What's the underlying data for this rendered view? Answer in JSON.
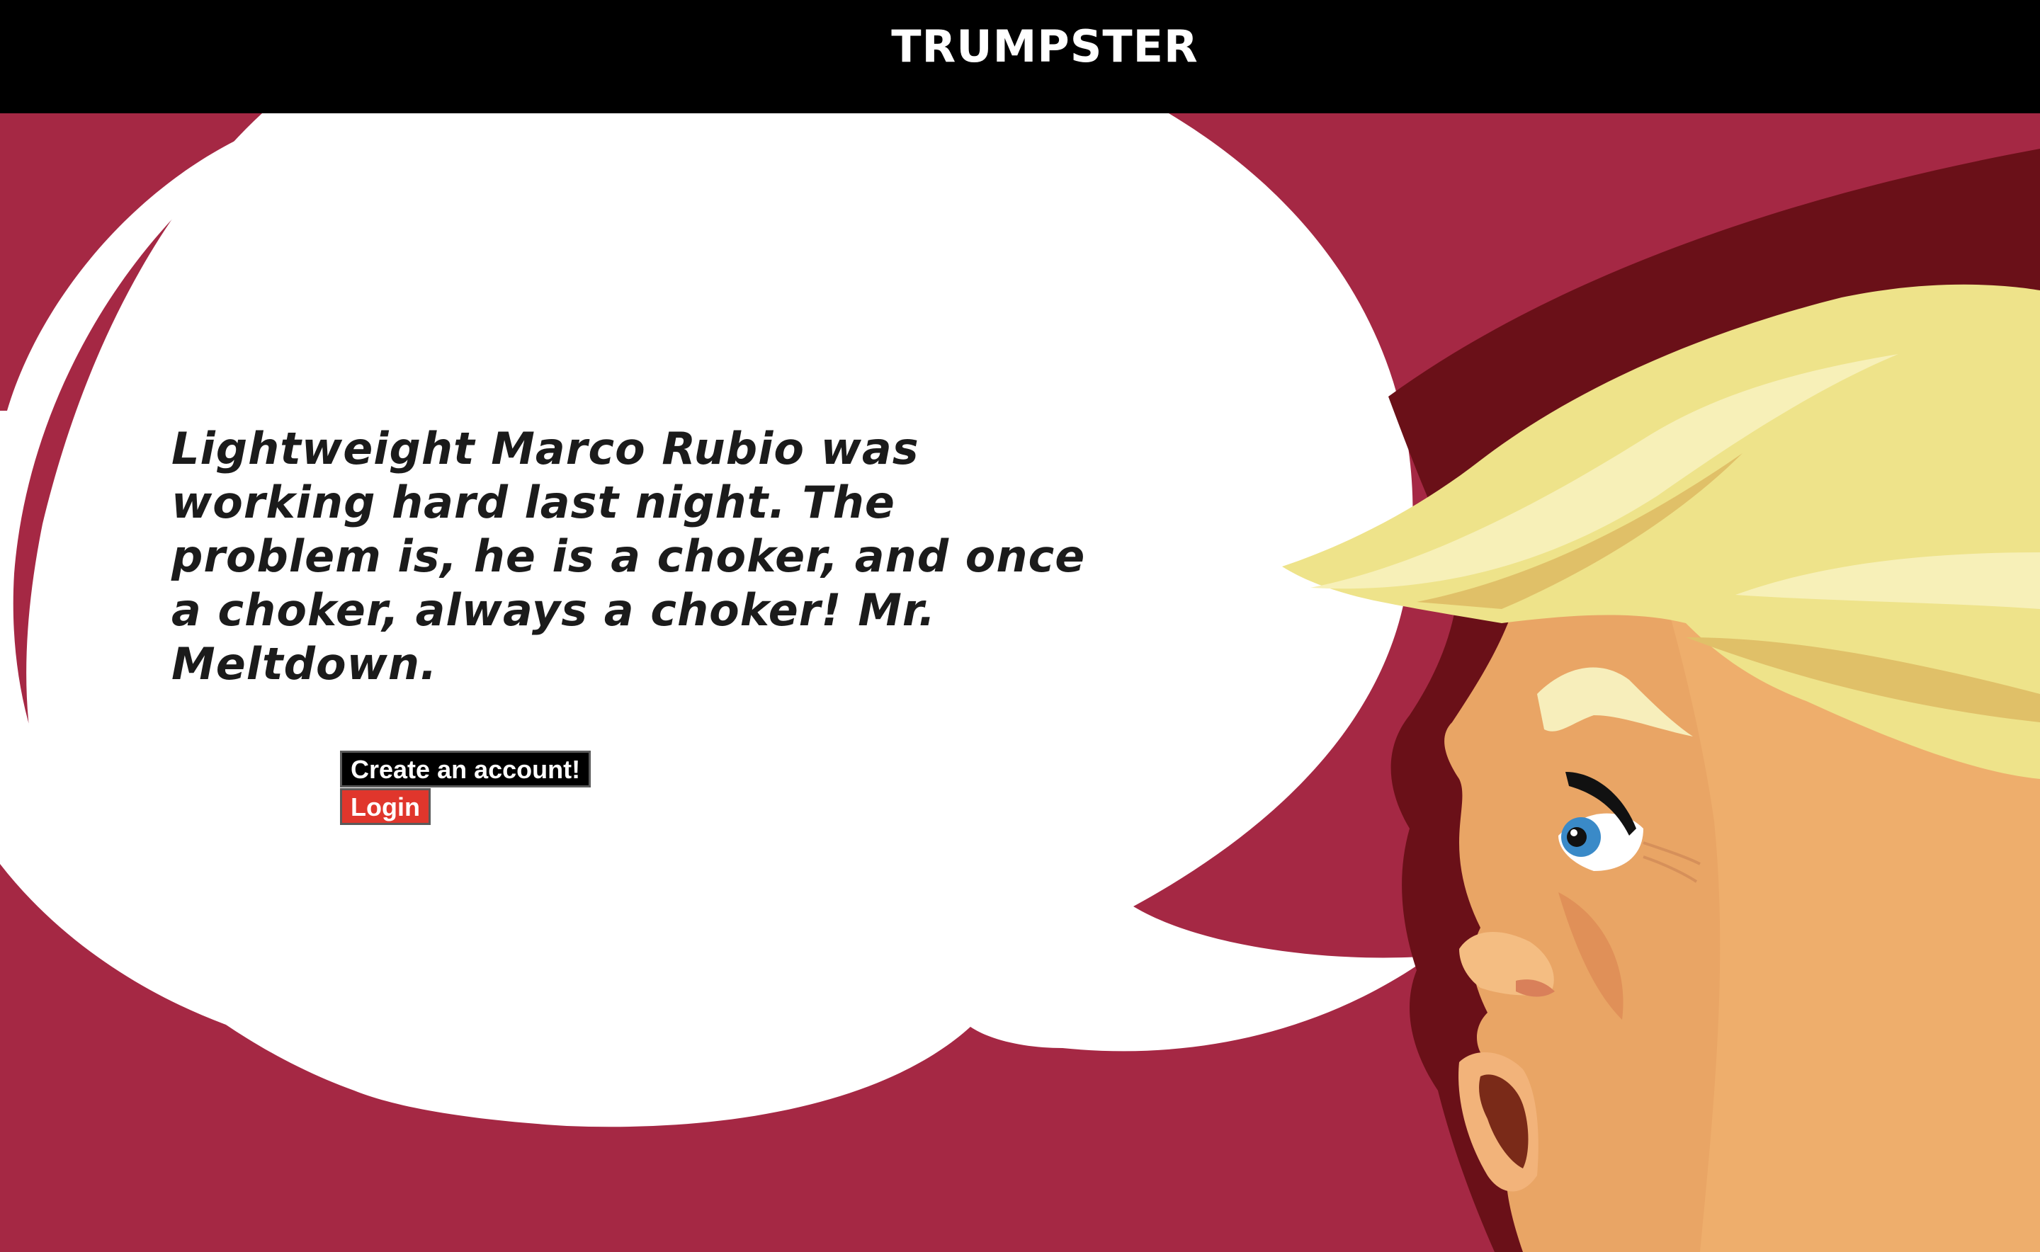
{
  "header": {
    "title": "TRUMPSTER"
  },
  "main": {
    "quote": "Lightweight Marco Rubio was working hard last night. The problem is, he is a choker, and once a choker, always a choker! Mr. Meltdown.",
    "create_account_label": "Create an account!",
    "login_label": "Login"
  },
  "colors": {
    "header_bg": "#000000",
    "background": "#a52844",
    "bubble": "#ffffff",
    "hair": "#f0e58c",
    "skin": "#e9a565",
    "login_button": "#e0362c",
    "create_button": "#000000"
  }
}
